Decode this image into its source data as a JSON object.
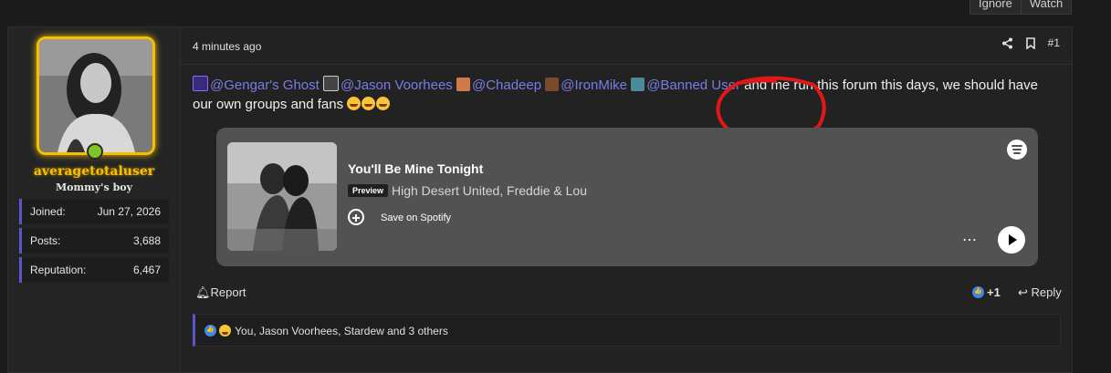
{
  "top_bar": {
    "ignore_label": "Ignore",
    "watch_label": "Watch"
  },
  "user": {
    "username": "averagetotaluser",
    "title": "Mommy's boy",
    "stats": [
      {
        "label": "Joined:",
        "value": "Jun 27, 2026"
      },
      {
        "label": "Posts:",
        "value": "3,688"
      },
      {
        "label": "Reputation:",
        "value": "6,467"
      }
    ]
  },
  "post": {
    "time": "4 minutes ago",
    "number": "#1",
    "mentions": [
      "@Gengar's Ghost",
      "@Jason Voorhees",
      "@Chadeep",
      "@IronMike",
      "@Banned User"
    ],
    "text_after": "and me run this forum this days, we should have our own groups and fans",
    "spotify": {
      "title": "You'll Be Mine Tonight",
      "preview_badge": "Preview",
      "artists": "High Desert United, Freddie & Lou",
      "save_label": "Save on Spotify"
    },
    "actions": {
      "report": "Report",
      "reaction_count": "+1",
      "reply": "Reply"
    },
    "reactions_summary": "You, Jason Voorhees, Stardew and 3 others"
  },
  "colors": {
    "accent": "#5a55c9",
    "mention": "#7b7be8",
    "username_gold": "#f5c000",
    "online": "#7dc623"
  }
}
